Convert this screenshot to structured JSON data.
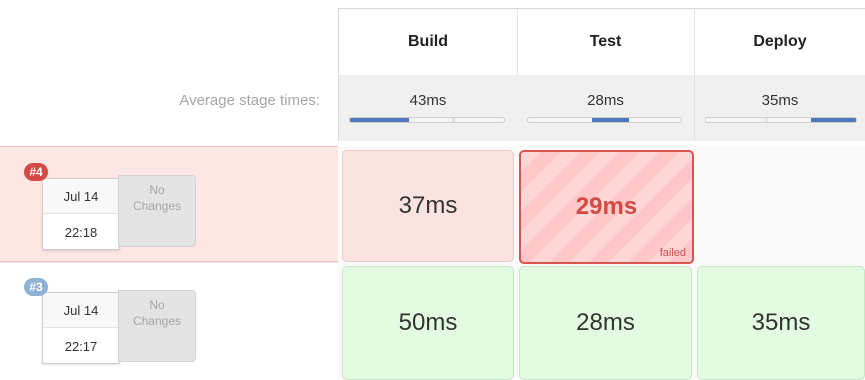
{
  "stages": {
    "build": {
      "label": "Build",
      "avg": "43ms",
      "bar_fill": [
        0.0,
        0.38
      ]
    },
    "test": {
      "label": "Test",
      "avg": "28ms",
      "bar_fill": [
        0.42,
        0.66
      ]
    },
    "deploy": {
      "label": "Deploy",
      "avg": "35ms",
      "bar_fill": [
        0.78,
        1.0
      ]
    }
  },
  "average_label": "Average stage times:",
  "runs": [
    {
      "badge": "#4",
      "date": "Jul 14",
      "time": "22:18",
      "changes_line1": "No",
      "changes_line2": "Changes",
      "build": "37ms",
      "test": "29ms",
      "test_status": "failed",
      "deploy": ""
    },
    {
      "badge": "#3",
      "date": "Jul 14",
      "time": "22:17",
      "changes_line1": "No",
      "changes_line2": "Changes",
      "build": "50ms",
      "test": "28ms",
      "deploy": "35ms"
    }
  ],
  "colors": {
    "failed": "#d24a43",
    "success_cell": "#e3fbe0",
    "unstable_row": "#fde6e3",
    "progress": "#4a79bf"
  }
}
